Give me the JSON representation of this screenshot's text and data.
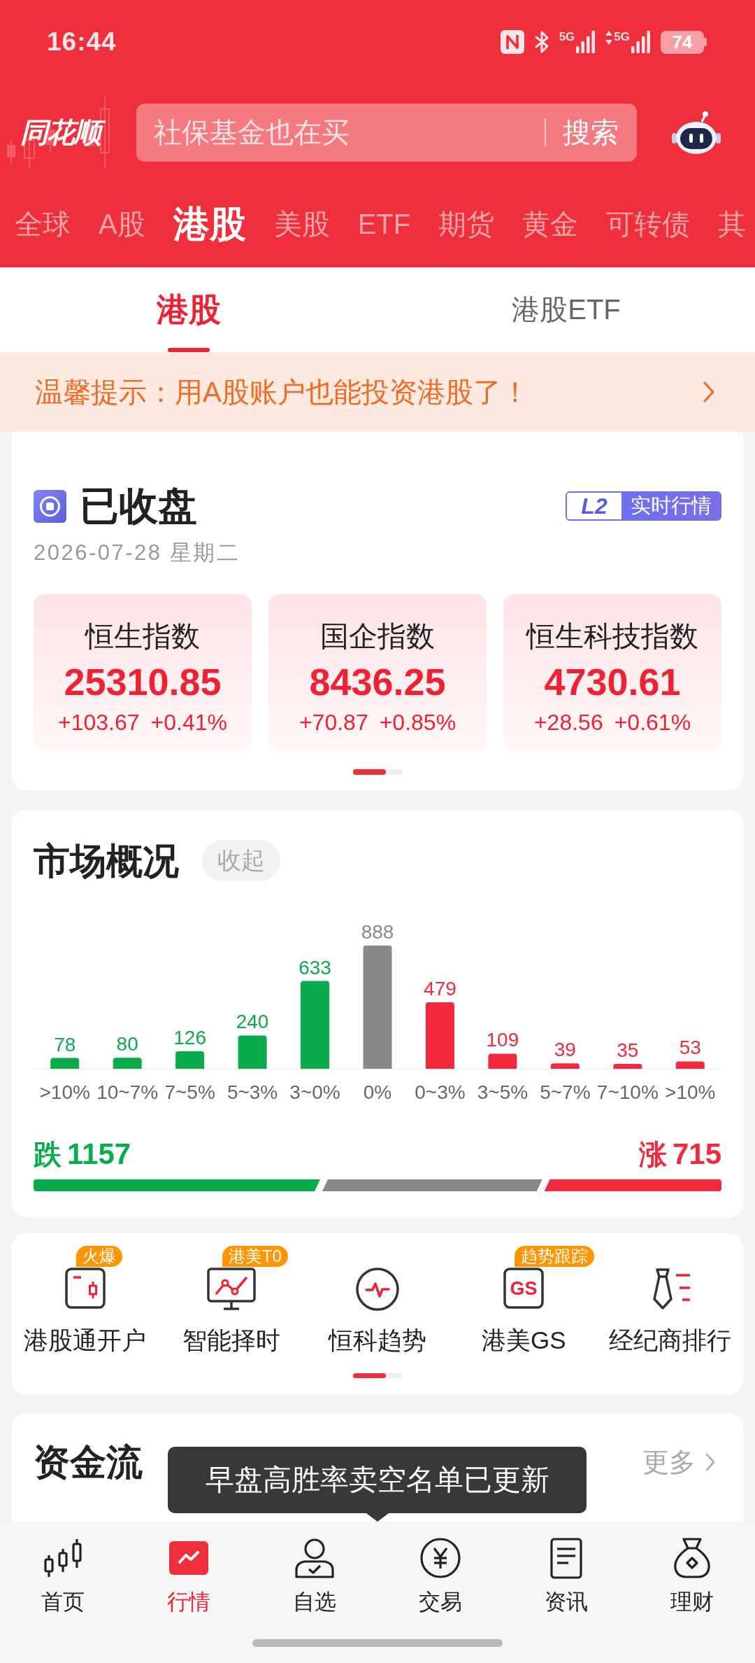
{
  "status_bar": {
    "time": "16:44",
    "networks": [
      {
        "label": "5G",
        "data_active": false
      },
      {
        "label": "5G",
        "data_active": true
      }
    ],
    "battery": "74"
  },
  "header": {
    "logo": "同花顺",
    "search": {
      "placeholder": "社保基金也在买",
      "button": "搜索"
    }
  },
  "market_tabs": [
    {
      "label": "全球",
      "selected": false
    },
    {
      "label": "A股",
      "selected": false
    },
    {
      "label": "港股",
      "selected": true
    },
    {
      "label": "美股",
      "selected": false
    },
    {
      "label": "ETF",
      "selected": false
    },
    {
      "label": "期货",
      "selected": false
    },
    {
      "label": "黄金",
      "selected": false
    },
    {
      "label": "可转债",
      "selected": false
    },
    {
      "label": "其",
      "selected": false
    }
  ],
  "sub_tabs": [
    {
      "label": "港股",
      "selected": true
    },
    {
      "label": "港股ETF",
      "selected": false
    }
  ],
  "notice": {
    "text": "温馨提示：用A股账户也能投资港股了！"
  },
  "market_status": {
    "title": "已收盘",
    "date": "2026-07-28 星期二",
    "badge": {
      "tag": "L2",
      "label": "实时行情"
    },
    "indices": [
      {
        "name": "恒生指数",
        "value": "25310.85",
        "change": "+103.67",
        "percent": "+0.41%",
        "rising": true
      },
      {
        "name": "国企指数",
        "value": "8436.25",
        "change": "+70.87",
        "percent": "+0.85%",
        "rising": true
      },
      {
        "name": "恒生科技指数",
        "value": "4730.61",
        "change": "+28.56",
        "percent": "+0.61%",
        "rising": true
      }
    ]
  },
  "market_overview": {
    "title": "市场概况",
    "collapse_button": "收起",
    "chart_data": {
      "type": "bar",
      "categories": [
        ">10%",
        "10~7%",
        "7~5%",
        "5~3%",
        "3~0%",
        "0%",
        "0~3%",
        "3~5%",
        "5~7%",
        "7~10%",
        ">10%"
      ],
      "series": [
        {
          "color": "#0aab4b",
          "values": [
            78,
            80,
            126,
            240,
            633,
            null,
            null,
            null,
            null,
            null,
            null
          ]
        },
        {
          "color": "#888888",
          "values": [
            null,
            null,
            null,
            null,
            null,
            888,
            null,
            null,
            null,
            null,
            null
          ]
        },
        {
          "color": "#f5293d",
          "values": [
            null,
            null,
            null,
            null,
            null,
            null,
            479,
            109,
            39,
            35,
            53
          ]
        }
      ],
      "data_labels": true
    },
    "fall": {
      "label": "跌",
      "count": "1157"
    },
    "rise": {
      "label": "涨",
      "count": "715"
    }
  },
  "shortcuts": [
    {
      "label": "港股通开户",
      "badge": "火爆"
    },
    {
      "label": "智能择时",
      "badge": "港美T0"
    },
    {
      "label": "恒科趋势"
    },
    {
      "label": "港美GS",
      "badge": "趋势跟踪",
      "icon_text": "GS"
    },
    {
      "label": "经纪商排行"
    }
  ],
  "fund_flow": {
    "title": "资金流",
    "more": "更多"
  },
  "tooltip": {
    "text": "早盘高胜率卖空名单已更新"
  },
  "bottom_nav": [
    {
      "label": "首页",
      "selected": false
    },
    {
      "label": "行情",
      "selected": true
    },
    {
      "label": "自选",
      "selected": false
    },
    {
      "label": "交易",
      "selected": false
    },
    {
      "label": "资讯",
      "selected": false
    },
    {
      "label": "理财",
      "selected": false
    }
  ]
}
